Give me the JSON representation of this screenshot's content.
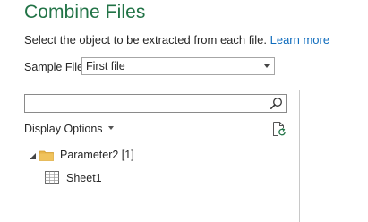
{
  "dialog": {
    "title": "Combine Files",
    "instruction": "Select the object to be extracted from each file.",
    "learn_more": "Learn more"
  },
  "sample_file": {
    "label": "Sample File:",
    "value": "First file"
  },
  "search": {
    "value": "",
    "placeholder": ""
  },
  "display_options": {
    "label": "Display Options"
  },
  "tree": {
    "folder": {
      "label": "Parameter2 [1]",
      "expanded": true,
      "icon": "folder-icon"
    },
    "items": [
      {
        "label": "Sheet1",
        "icon": "sheet-icon"
      }
    ]
  },
  "colors": {
    "title": "#217346",
    "link": "#0f6cbd",
    "folder": "#e8b64b",
    "text": "#262626"
  }
}
